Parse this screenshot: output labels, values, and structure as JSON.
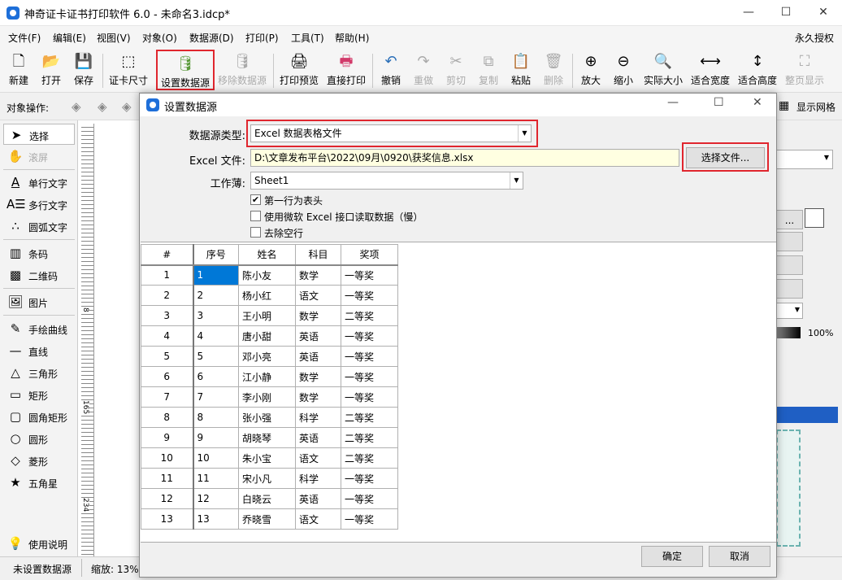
{
  "app": {
    "title": "神奇证卡证书打印软件 6.0 - 未命名3.idcp*",
    "minimize": "—",
    "maximize": "☐",
    "close": "✕"
  },
  "menu": {
    "items": [
      "文件(F)",
      "编辑(E)",
      "视图(V)",
      "对象(O)",
      "数据源(D)",
      "打印(P)",
      "工具(T)",
      "帮助(H)"
    ],
    "license": "永久授权"
  },
  "toolbar": {
    "buttons": [
      {
        "label": "新建",
        "icon": "new-file-icon"
      },
      {
        "label": "打开",
        "icon": "open-file-icon"
      },
      {
        "label": "保存",
        "icon": "save-icon"
      },
      {
        "label": "证卡尺寸",
        "icon": "card-size-icon"
      },
      {
        "label": "设置数据源",
        "icon": "database-icon"
      },
      {
        "label": "移除数据源",
        "icon": "remove-database-icon"
      },
      {
        "label": "打印预览",
        "icon": "print-preview-icon"
      },
      {
        "label": "直接打印",
        "icon": "printer-icon"
      },
      {
        "label": "撤销",
        "icon": "undo-icon"
      },
      {
        "label": "重做",
        "icon": "redo-icon"
      },
      {
        "label": "剪切",
        "icon": "cut-icon"
      },
      {
        "label": "复制",
        "icon": "copy-icon"
      },
      {
        "label": "粘贴",
        "icon": "paste-icon"
      },
      {
        "label": "删除",
        "icon": "trash-icon"
      },
      {
        "label": "放大",
        "icon": "zoom-in-icon"
      },
      {
        "label": "缩小",
        "icon": "zoom-out-icon"
      },
      {
        "label": "实际大小",
        "icon": "actual-size-icon"
      },
      {
        "label": "适合宽度",
        "icon": "fit-width-icon"
      },
      {
        "label": "适合高度",
        "icon": "fit-height-icon"
      },
      {
        "label": "整页显示",
        "icon": "full-page-icon"
      }
    ]
  },
  "object_ops": {
    "label": "对象操作:",
    "show_grid": "显示网格"
  },
  "left_tools": [
    {
      "label": "选择",
      "icon": "arrow-cursor-icon"
    },
    {
      "label": "滚屏",
      "icon": "hand-icon"
    },
    {
      "label": "单行文字",
      "icon": "single-line-text-icon"
    },
    {
      "label": "多行文字",
      "icon": "multi-line-text-icon"
    },
    {
      "label": "圆弧文字",
      "icon": "arc-text-icon"
    },
    {
      "label": "条码",
      "icon": "barcode-icon"
    },
    {
      "label": "二维码",
      "icon": "qrcode-icon"
    },
    {
      "label": "图片",
      "icon": "image-icon"
    },
    {
      "label": "手绘曲线",
      "icon": "pen-icon"
    },
    {
      "label": "直线",
      "icon": "line-icon"
    },
    {
      "label": "三角形",
      "icon": "triangle-icon"
    },
    {
      "label": "矩形",
      "icon": "rectangle-icon"
    },
    {
      "label": "圆角矩形",
      "icon": "rounded-rectangle-icon"
    },
    {
      "label": "圆形",
      "icon": "circle-icon"
    },
    {
      "label": "菱形",
      "icon": "diamond-icon"
    },
    {
      "label": "五角星",
      "icon": "star-icon"
    },
    {
      "label": "使用说明",
      "icon": "lightbulb-icon"
    }
  ],
  "ruler_marks": [
    "8",
    "165",
    "234"
  ],
  "right_panel": {
    "percent": "100%",
    "btn_text": "..."
  },
  "status": {
    "datasource": "未设置数据源",
    "zoom": "缩放: 13%"
  },
  "dialog": {
    "title": "设置数据源",
    "source_type_label": "数据源类型:",
    "source_type_value": "Excel 数据表格文件",
    "excel_file_label": "Excel 文件:",
    "excel_file_value": "D:\\文章发布平台\\2022\\09月\\0920\\获奖信息.xlsx",
    "choose_file": "选择文件...",
    "sheet_label": "工作薄:",
    "sheet_value": "Sheet1",
    "checkboxes": [
      {
        "label": "第一行为表头",
        "checked": true
      },
      {
        "label": "使用微软 Excel 接口读取数据（慢）",
        "checked": false
      },
      {
        "label": "去除空行",
        "checked": false
      }
    ],
    "ok": "确定",
    "cancel": "取消",
    "table": {
      "headers": [
        "#",
        "序号",
        "姓名",
        "科目",
        "奖项"
      ],
      "rows": [
        [
          "1",
          "1",
          "陈小友",
          "数学",
          "一等奖"
        ],
        [
          "2",
          "2",
          "杨小红",
          "语文",
          "一等奖"
        ],
        [
          "3",
          "3",
          "王小明",
          "数学",
          "二等奖"
        ],
        [
          "4",
          "4",
          "唐小甜",
          "英语",
          "一等奖"
        ],
        [
          "5",
          "5",
          "邓小亮",
          "英语",
          "一等奖"
        ],
        [
          "6",
          "6",
          "江小静",
          "数学",
          "一等奖"
        ],
        [
          "7",
          "7",
          "李小刚",
          "数学",
          "一等奖"
        ],
        [
          "8",
          "8",
          "张小强",
          "科学",
          "二等奖"
        ],
        [
          "9",
          "9",
          "胡晓琴",
          "英语",
          "二等奖"
        ],
        [
          "10",
          "10",
          "朱小宝",
          "语文",
          "二等奖"
        ],
        [
          "11",
          "11",
          "宋小凡",
          "科学",
          "一等奖"
        ],
        [
          "12",
          "12",
          "白晓云",
          "英语",
          "一等奖"
        ],
        [
          "13",
          "13",
          "乔晓雪",
          "语文",
          "一等奖"
        ]
      ]
    }
  }
}
